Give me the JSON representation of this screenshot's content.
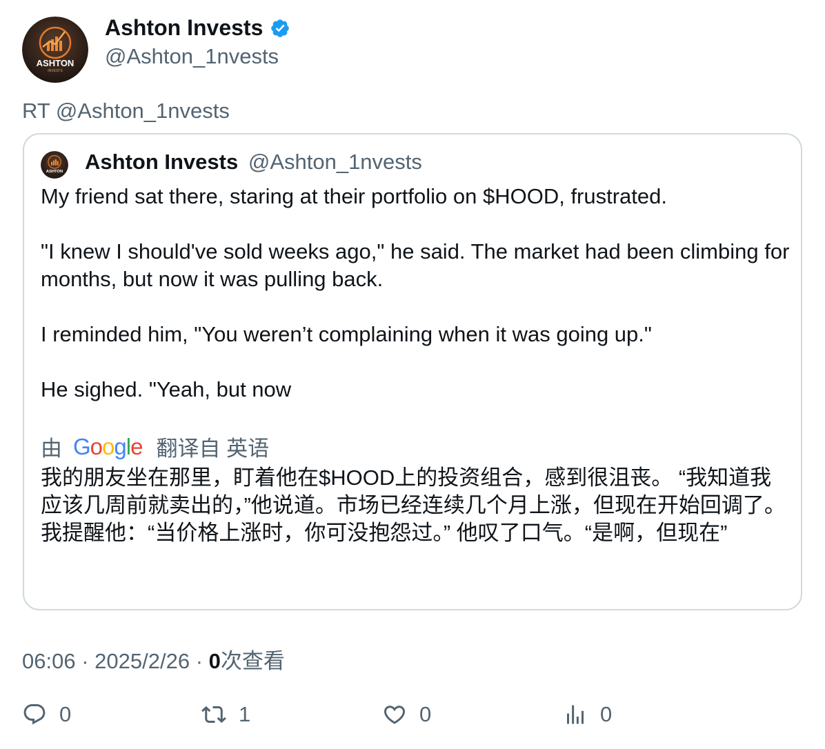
{
  "author": {
    "name": "Ashton Invests",
    "handle": "@Ashton_1nvests",
    "verified": true,
    "avatar_text": "ASHTON",
    "avatar_subtext": "INVESTS"
  },
  "retweet_line": "RT @Ashton_1nvests",
  "quoted": {
    "name": "Ashton Invests",
    "handle": "@Ashton_1nvests",
    "paragraphs": [
      "My friend sat there, staring at their portfolio on $HOOD, frustrated.",
      "\"I knew I should've sold weeks ago,\" he said. The market had been climbing for months, but now it was pulling back.",
      "I reminded him, \"You weren’t complaining when it was going up.\"",
      "He sighed. \"Yeah, but now"
    ],
    "translation": {
      "prefix": "由",
      "provider": "Google",
      "suffix": "翻译自 英语",
      "text": "我的朋友坐在那里，盯着他在$HOOD上的投资组合，感到很沮丧。 “我知道我应该几周前就卖出的，”他说道。市场已经连续几个月上涨，但现在开始回调了。 我提醒他：“当价格上涨时，你可没抱怨过。” 他叹了口气。“是啊，但现在”"
    }
  },
  "meta": {
    "time": "06:06",
    "separator": "·",
    "date": "2025/2/26",
    "views_count": "0",
    "views_label": "次查看"
  },
  "actions": {
    "replies": "0",
    "retweets": "1",
    "likes": "0",
    "views": "0"
  },
  "colors": {
    "text_primary": "#0f1419",
    "text_secondary": "#536471",
    "border": "#cfd9de",
    "verified": "#1d9bf0"
  }
}
